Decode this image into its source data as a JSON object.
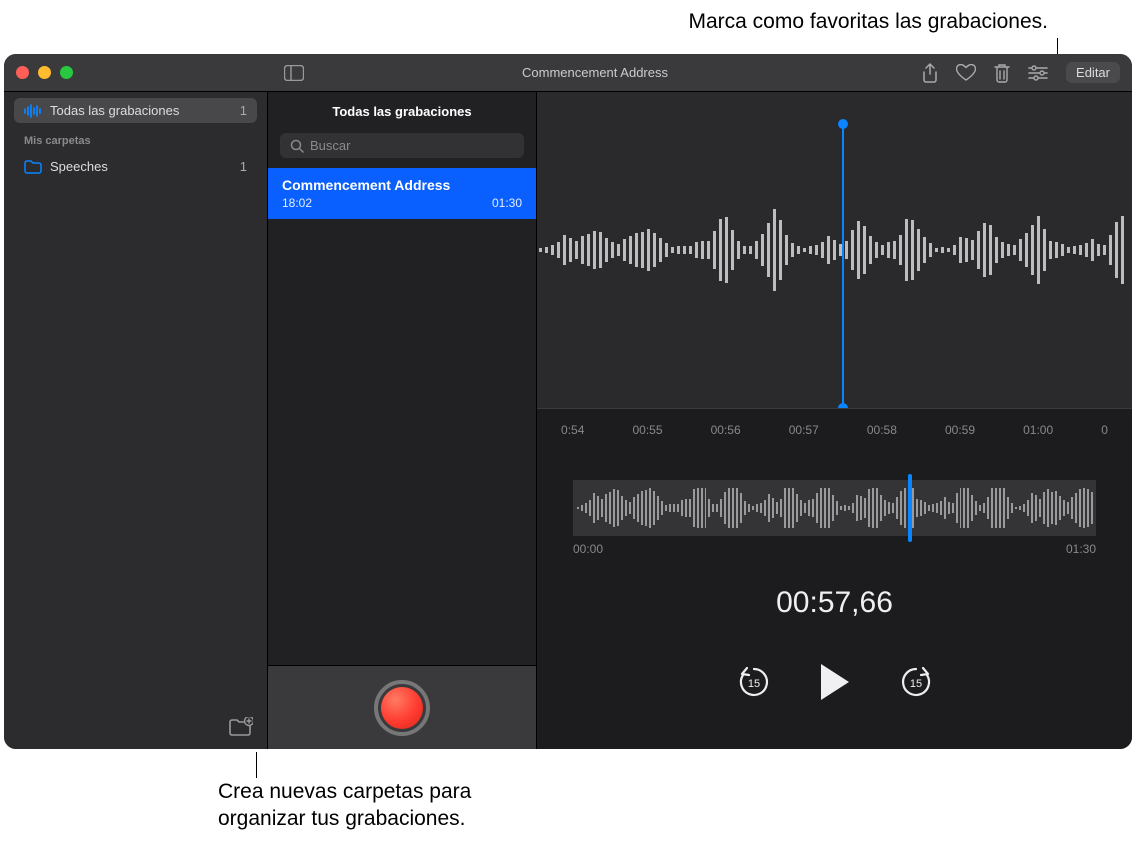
{
  "callouts": {
    "favorite": "Marca como favoritas las grabaciones.",
    "folders_l1": "Crea nuevas carpetas para",
    "folders_l2": "organizar tus grabaciones."
  },
  "toolbar": {
    "title": "Commencement Address",
    "edit": "Editar"
  },
  "sidebar": {
    "all_label": "Todas las grabaciones",
    "all_count": "1",
    "header": "Mis carpetas",
    "folders": [
      {
        "label": "Speeches",
        "count": "1"
      }
    ]
  },
  "list": {
    "title": "Todas las grabaciones",
    "search_ph": "Buscar",
    "items": [
      {
        "title": "Commencement Address",
        "time": "18:02",
        "dur": "01:30"
      }
    ]
  },
  "detail": {
    "ticks": [
      "0:54",
      "00:55",
      "00:56",
      "00:57",
      "00:58",
      "00:59",
      "01:00",
      "0"
    ],
    "ov_start": "00:00",
    "ov_end": "01:30",
    "timecode": "00:57,66",
    "skip": "15"
  }
}
